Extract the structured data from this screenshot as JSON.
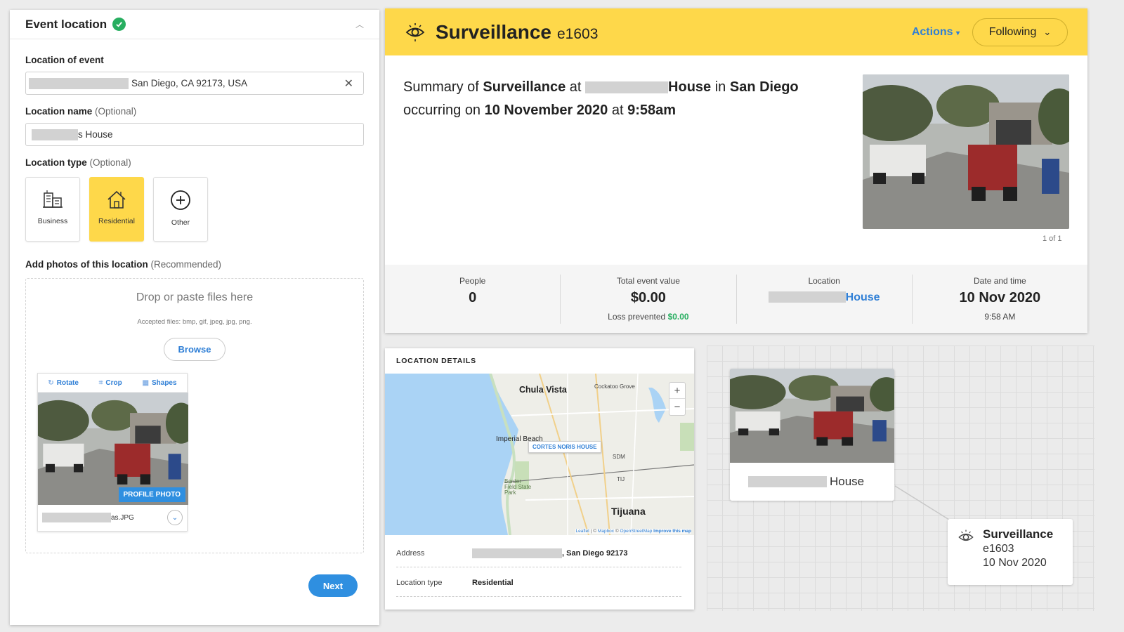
{
  "left_panel": {
    "title": "Event location",
    "location_of_event_label": "Location of event",
    "location_value": "San Diego, CA 92173, USA",
    "location_name_label": "Location name",
    "optional_text": "(Optional)",
    "location_name_value": "s House",
    "location_type_label": "Location type",
    "types": [
      {
        "label": "Business",
        "icon": "building-icon",
        "selected": false
      },
      {
        "label": "Residential",
        "icon": "house-icon",
        "selected": true
      },
      {
        "label": "Other",
        "icon": "plus-circle-icon",
        "selected": false
      }
    ],
    "photos_label": "Add photos of this location",
    "recommended_text": "(Recommended)",
    "drop_title": "Drop or paste files here",
    "accepted_files": "Accepted files: bmp, gif, jpeg, jpg, png.",
    "browse_label": "Browse",
    "tools": {
      "rotate": "Rotate",
      "crop": "Crop",
      "shapes": "Shapes"
    },
    "profile_badge": "PROFILE PHOTO",
    "file_name": "as.JPG",
    "next_label": "Next"
  },
  "summary": {
    "type": "Surveillance",
    "event_id": "e1603",
    "actions_label": "Actions",
    "following_label": "Following",
    "text": {
      "prefix": "Summary of",
      "type": "Surveillance",
      "at": "at",
      "place": "House",
      "in": "in",
      "city": "San Diego",
      "occurring": "occurring on",
      "date": "10 November 2020",
      "at2": "at",
      "time": "9:58am"
    },
    "pager": "1 of 1",
    "stats": {
      "people_label": "People",
      "people_value": "0",
      "value_label": "Total event value",
      "value_value": "$0.00",
      "loss_label": "Loss prevented",
      "loss_value": "$0.00",
      "location_label": "Location",
      "location_value": "House",
      "datetime_label": "Date and time",
      "date_value": "10 Nov 2020",
      "time_value": "9:58 AM"
    }
  },
  "location_details": {
    "title": "LOCATION DETAILS",
    "map": {
      "labels": {
        "chula_vista": "Chula Vista",
        "cockatoo": "Cockatoo Grove",
        "imperial": "Imperial Beach",
        "pin": "CORTES NORIS HOUSE",
        "sdm": "SDM",
        "tij": "TIJ",
        "border_park": "Border Field State Park",
        "tijuana": "Tijuana"
      },
      "zoom_in": "+",
      "zoom_out": "−",
      "attribution": {
        "leaflet": "Leaflet",
        "sep1": "| ©",
        "mapbox": "Mapbox",
        "sep2": "©",
        "osm": "OpenStreetMap",
        "improve": "Improve this map"
      }
    },
    "address_label": "Address",
    "address_value": ", San Diego 92173",
    "type_label": "Location type",
    "type_value": "Residential"
  },
  "graph": {
    "location_caption": "House",
    "event_type": "Surveillance",
    "event_id": "e1603",
    "event_date": "10 Nov 2020"
  },
  "colors": {
    "accent_yellow": "#fed84a",
    "link_blue": "#2f7fd6",
    "success_green": "#27ae60"
  }
}
